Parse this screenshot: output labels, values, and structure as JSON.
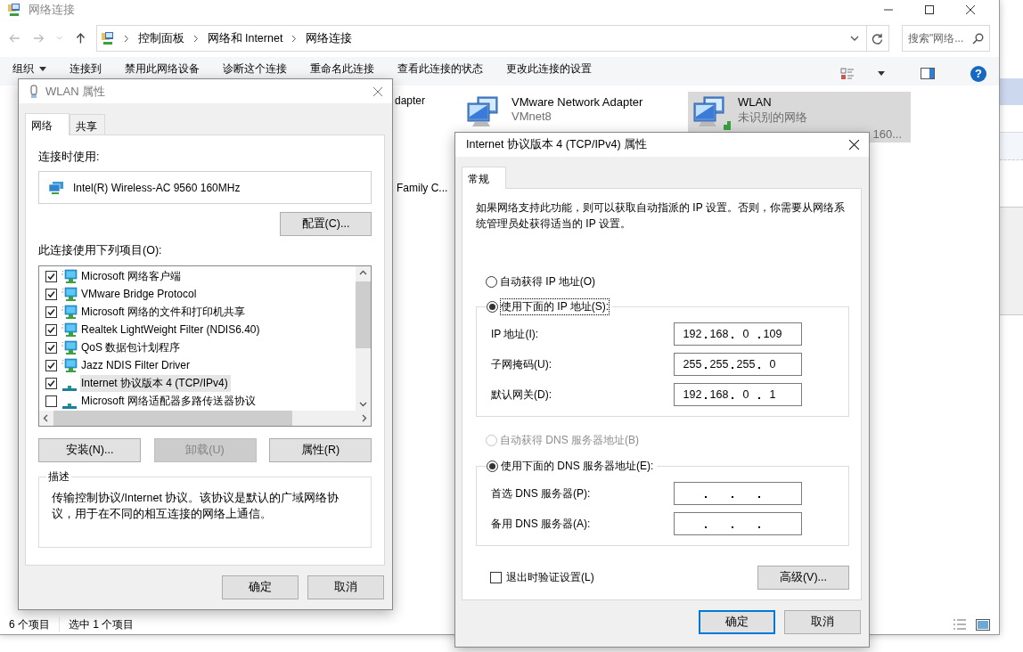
{
  "explorer": {
    "title": "网络连接",
    "breadcrumb": [
      "控制面板",
      "网络和 Internet",
      "网络连接"
    ],
    "search": {
      "placeholder": "搜索\"网络..."
    },
    "toolbar": [
      {
        "label": "组织",
        "kind": "menu"
      },
      {
        "label": "连接到",
        "kind": "command"
      },
      {
        "label": "禁用此网络设备",
        "kind": "command"
      },
      {
        "label": "诊断这个连接",
        "kind": "command"
      },
      {
        "label": "重命名此连接",
        "kind": "command"
      },
      {
        "label": "查看此连接的状态",
        "kind": "command"
      },
      {
        "label": "更改此连接的设置",
        "kind": "command"
      }
    ],
    "help_button": "?",
    "items": [
      {
        "kind": "fragment",
        "lines": [
          "dapter"
        ]
      },
      {
        "kind": "fragment",
        "lines": [
          "Family C..."
        ]
      },
      {
        "kind": "adapter",
        "lines": [
          "VMware Network Adapter",
          "VMnet8"
        ],
        "selected": false
      },
      {
        "kind": "adapter",
        "lines": [
          "WLAN",
          "未识别的网络"
        ],
        "detail": "160...",
        "selected": true
      }
    ],
    "status": [
      "6 个项目",
      "选中 1 个项目"
    ]
  },
  "wlan_dialog": {
    "title": "WLAN 属性",
    "tabs": [
      {
        "label": "网络",
        "selected": true
      },
      {
        "label": "共享",
        "selected": false
      }
    ],
    "connect_using_label": "连接时使用:",
    "adapter": "Intel(R) Wireless-AC 9560 160MHz",
    "configure_button": "配置(C)...",
    "items_label": "此连接使用下列项目(O):",
    "items": [
      {
        "label": "Microsoft 网络客户端",
        "kind": "service",
        "checked": true,
        "selected": false
      },
      {
        "label": "VMware Bridge Protocol",
        "kind": "service",
        "checked": true,
        "selected": false
      },
      {
        "label": "Microsoft 网络的文件和打印机共享",
        "kind": "service",
        "checked": true,
        "selected": false
      },
      {
        "label": "Realtek LightWeight Filter (NDIS6.40)",
        "kind": "service",
        "checked": true,
        "selected": false
      },
      {
        "label": "QoS 数据包计划程序",
        "kind": "service",
        "checked": true,
        "selected": false
      },
      {
        "label": "Jazz NDIS Filter Driver",
        "kind": "service",
        "checked": true,
        "selected": false
      },
      {
        "label": "Internet 协议版本 4 (TCP/IPv4)",
        "kind": "protocol",
        "checked": true,
        "selected": true
      },
      {
        "label": "Microsoft 网络适配器多路传送器协议",
        "kind": "protocol",
        "checked": false,
        "selected": false
      }
    ],
    "buttons": [
      {
        "label": "安装(N)...",
        "disabled": false
      },
      {
        "label": "卸载(U)",
        "disabled": true
      },
      {
        "label": "属性(R)",
        "disabled": false
      }
    ],
    "description": {
      "title": "描述",
      "text": "传输控制协议/Internet 协议。该协议是默认的广域网络协议，用于在不同的相互连接的网络上通信。"
    },
    "footer_buttons": [
      {
        "label": "确定",
        "default": false
      },
      {
        "label": "取消",
        "default": false
      }
    ]
  },
  "ipv4_dialog": {
    "title": "Internet 协议版本 4 (TCP/IPv4) 属性",
    "tabs": [
      {
        "label": "常规",
        "selected": true
      }
    ],
    "intro": "如果网络支持此功能，则可以获取自动指派的 IP 设置。否则，你需要从网络系统管理员处获得适当的 IP 设置。",
    "ip_mode": [
      {
        "label": "自动获得 IP 地址(O)",
        "selected": false,
        "disabled": false,
        "focused": false
      },
      {
        "label": "使用下面的 IP 地址(S):",
        "selected": true,
        "disabled": false,
        "focused": true
      }
    ],
    "ip_fields": [
      {
        "label": "IP 地址(I):",
        "octets": [
          "192",
          "168",
          "0",
          "109"
        ]
      },
      {
        "label": "子网掩码(U):",
        "octets": [
          "255",
          "255",
          "255",
          "0"
        ]
      },
      {
        "label": "默认网关(D):",
        "octets": [
          "192",
          "168",
          "0",
          "1"
        ]
      }
    ],
    "dns_mode": [
      {
        "label": "自动获得 DNS 服务器地址(B)",
        "selected": false,
        "disabled": true,
        "focused": false
      },
      {
        "label": "使用下面的 DNS 服务器地址(E):",
        "selected": true,
        "disabled": false,
        "focused": false
      }
    ],
    "dns_fields": [
      {
        "label": "首选 DNS 服务器(P):"
      },
      {
        "label": "备用 DNS 服务器(A):"
      }
    ],
    "validate": {
      "label": "退出时验证设置(L)",
      "checked": false
    },
    "advanced_button": "高级(V)...",
    "footer_buttons": [
      {
        "label": "确定",
        "default": true
      },
      {
        "label": "取消",
        "default": false
      }
    ]
  }
}
